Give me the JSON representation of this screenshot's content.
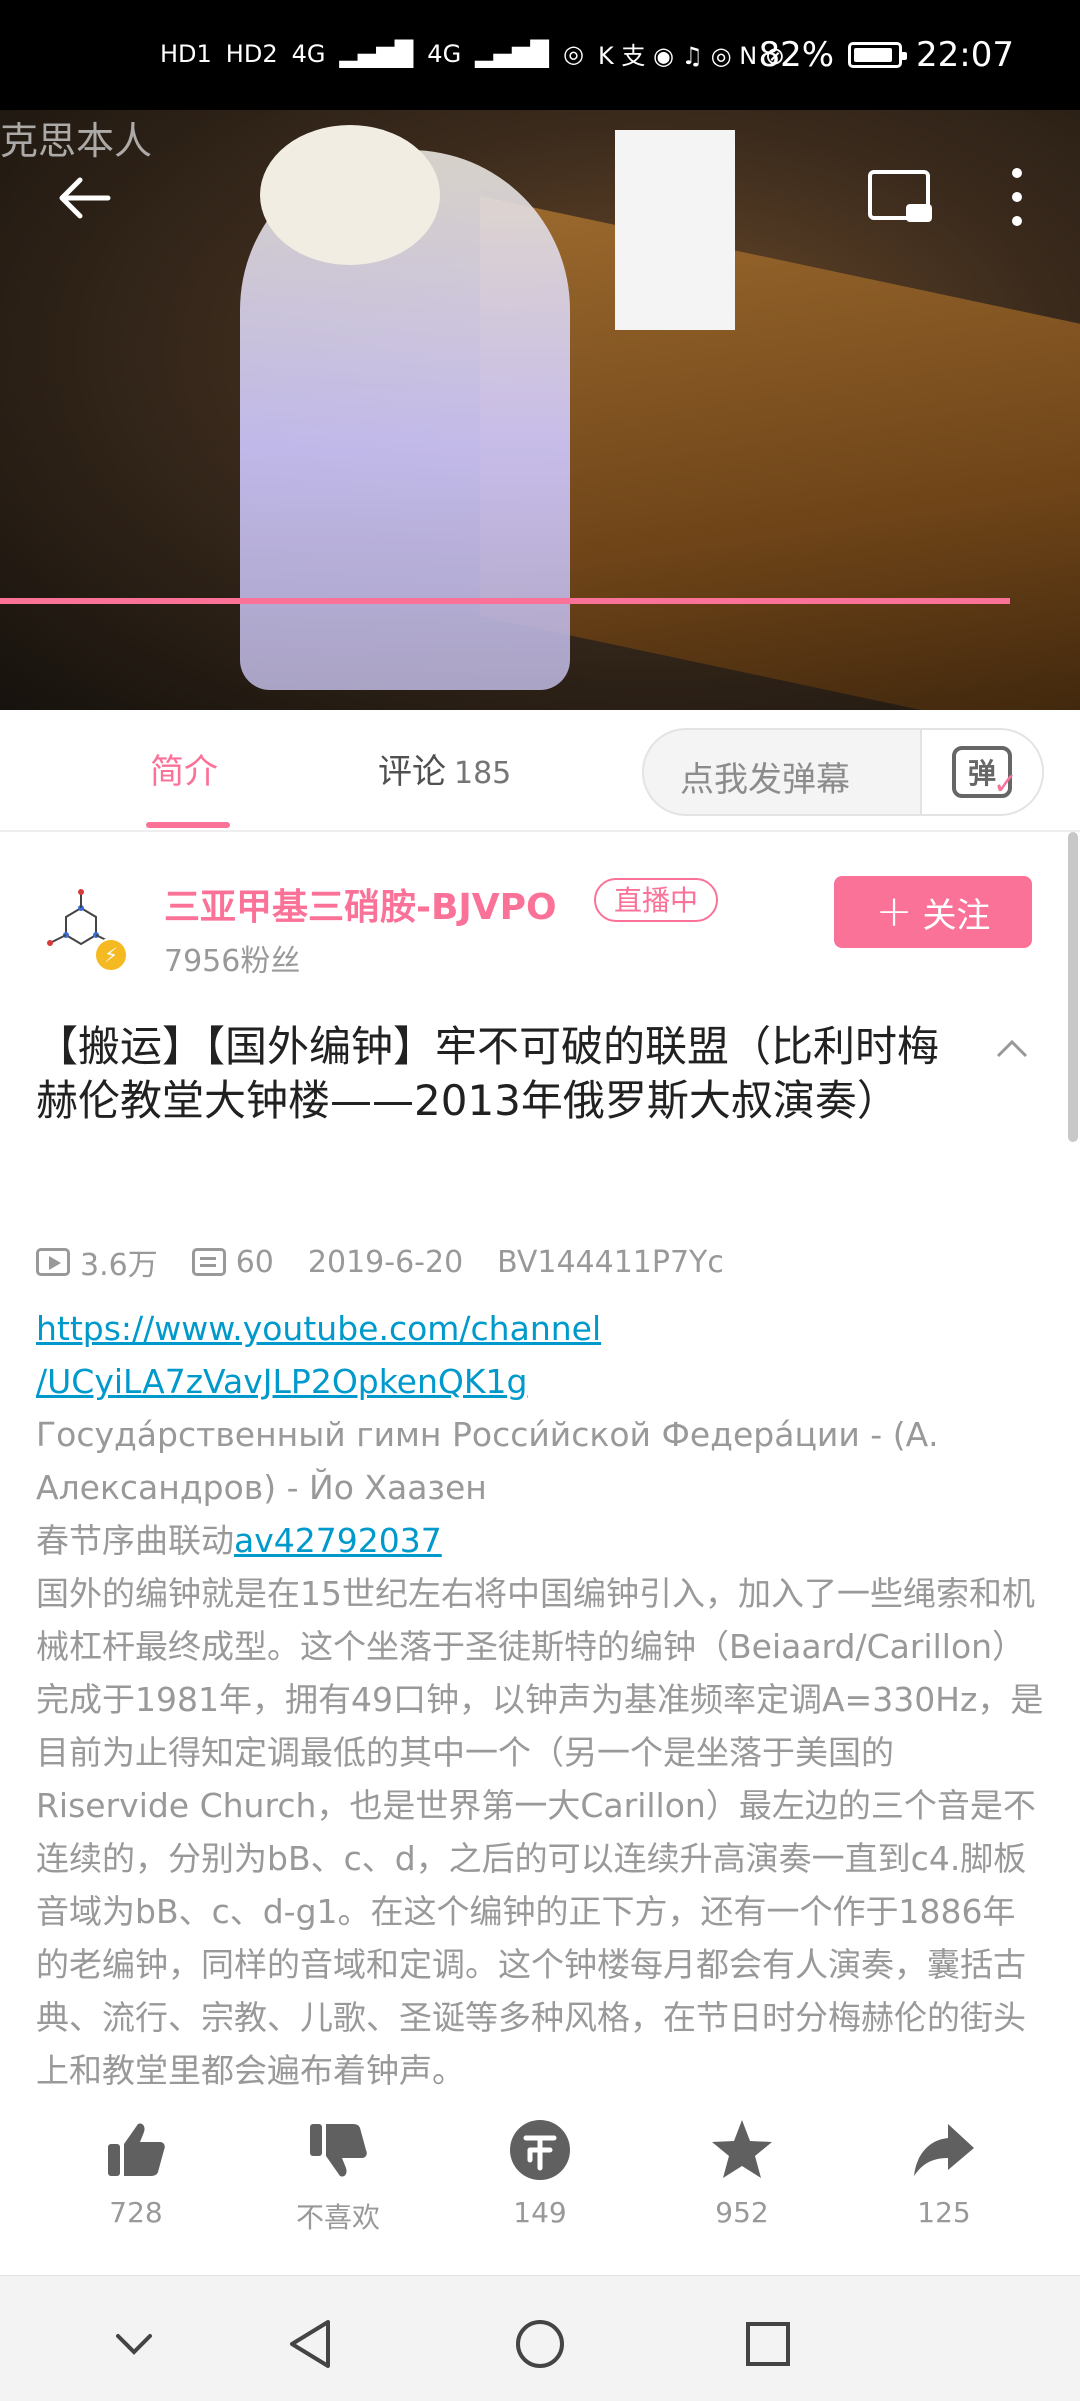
{
  "status_bar": {
    "left_labels": [
      "HD1",
      "HD2",
      "4G",
      "4G"
    ],
    "battery_percent": "82%",
    "time": "22:07"
  },
  "video": {
    "watermark": "克思本人",
    "progress": 0.935
  },
  "tabs": {
    "intro_label": "简介",
    "comments_label": "评论",
    "comments_count": "185",
    "danmaku_placeholder": "点我发弹幕",
    "danmaku_button_glyph": "弹"
  },
  "uploader": {
    "name": "三亚甲基三硝胺-BJVPO",
    "live_badge": "直播中",
    "fans": "7956粉丝",
    "follow_label": "关注"
  },
  "video_info": {
    "title": "【搬运】【国外编钟】牢不可破的联盟（比利时梅赫伦教堂大钟楼——2013年俄罗斯大叔演奏）",
    "views": "3.6万",
    "danmaku_count": "60",
    "date": "2019-6-20",
    "bvid": "BV144411P7Yc"
  },
  "description": {
    "link_line1": "https://www.youtube.com/channel",
    "link_line2": "/UCyiLA7zVavJLP2OpkenQK1g",
    "anthem": "Госуда́рственный гимн Росси́йской Федера́ции - (А. Александров) - Йо Хаазен",
    "festival_prefix": "春节序曲联动",
    "festival_link": "av42792037",
    "body": "国外的编钟就是在15世纪左右将中国编钟引入，加入了一些绳索和机械杠杆最终成型。这个坐落于圣徒斯特的编钟（Beiaard/Carillon）完成于1981年，拥有49口钟，以钟声为基准频率定调A=330Hz，是目前为止得知定调最低的其中一个（另一个是坐落于美国的Riservide Church，也是世界第一大Carillon）最左边的三个音是不连续的，分别为bB、c、d，之后的可以连续升高演奏一直到c4.脚板音域为bB、c、d-g1。在这个编钟的正下方，还有一个作于1886年的老编钟，同样的音域和定调。这个钟楼每月都会有人演奏，囊括古典、流行、宗教、儿歌、圣诞等多种风格，在节日时分梅赫伦的街头上和教堂里都会遍布着钟声。"
  },
  "actions": {
    "like": "728",
    "dislike": "不喜欢",
    "coin": "149",
    "favorite": "952",
    "share": "125"
  },
  "colors": {
    "accent": "#fb7299",
    "link": "#0099cc",
    "muted": "#999999"
  }
}
